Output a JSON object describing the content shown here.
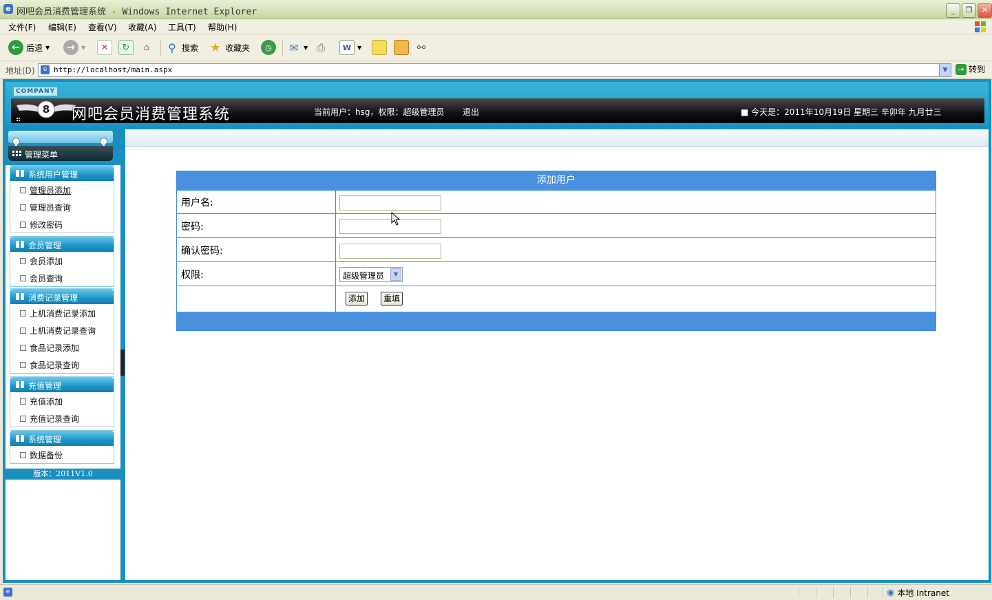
{
  "window": {
    "title": "网吧会员消费管理系统 - Windows Internet Explorer"
  },
  "menubar": {
    "items": [
      "文件(F)",
      "编辑(E)",
      "查看(V)",
      "收藏(A)",
      "工具(T)",
      "帮助(H)"
    ]
  },
  "toolbar": {
    "back_label": "后退",
    "search_label": "搜索",
    "favorites_label": "收藏夹"
  },
  "addressbar": {
    "label": "地址(D)",
    "url": "http://localhost/main.aspx",
    "go_label": "转到"
  },
  "header": {
    "company": "COMPANY",
    "logo_text": "8",
    "system_title": "网吧会员消费管理系统",
    "user_info": "当前用户：hsg，权限：超级管理员",
    "logout": "退出",
    "date": "■ 今天是：2011年10月19日 星期三 辛卯年 九月廿三"
  },
  "sidebar": {
    "menu_title": "管理菜单",
    "groups": [
      {
        "title": "系统用户管理",
        "items": [
          "管理员添加",
          "管理员查询",
          "修改密码"
        ]
      },
      {
        "title": "会员管理",
        "items": [
          "会员添加",
          "会员查询"
        ]
      },
      {
        "title": "消费记录管理",
        "items": [
          "上机消费记录添加",
          "上机消费记录查询",
          "食品记录添加",
          "食品记录查询"
        ]
      },
      {
        "title": "充值管理",
        "items": [
          "充值添加",
          "充值记录查询"
        ]
      },
      {
        "title": "系统管理",
        "items": [
          "数据备份"
        ]
      }
    ],
    "version": "版本：2011V1.0"
  },
  "form": {
    "title": "添加用户",
    "username_label": "用户名:",
    "username_value": "",
    "password_label": "密码:",
    "password_value": "",
    "confirm_label": "确认密码:",
    "confirm_value": "",
    "role_label": "权限:",
    "role_value": "超级管理员",
    "add_button": "添加",
    "reset_button": "重填"
  },
  "statusbar": {
    "zone": "本地 Intranet"
  },
  "colors": {
    "frame": "#1a8fbf",
    "form_header": "#4a90de",
    "form_border": "#3c8fdc"
  }
}
